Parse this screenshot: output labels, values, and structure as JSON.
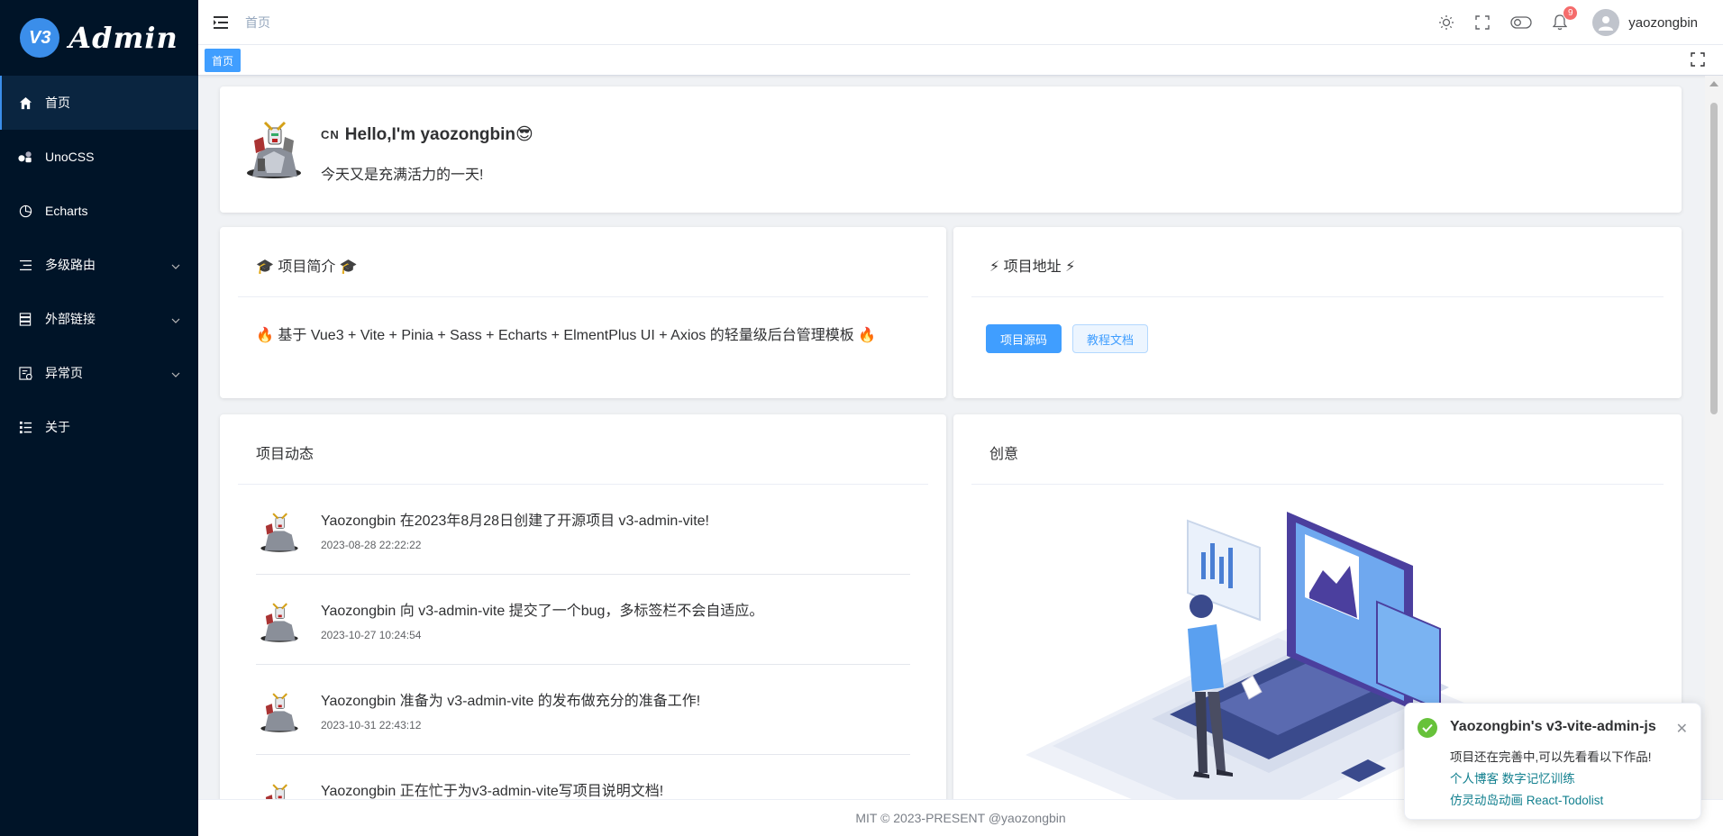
{
  "app": {
    "logo_badge": "V3",
    "logo_text": "Admin"
  },
  "sidebar": {
    "items": [
      {
        "label": "首页",
        "icon": "home-icon",
        "active": true
      },
      {
        "label": "UnoCSS",
        "icon": "shapes-icon"
      },
      {
        "label": "Echarts",
        "icon": "pie-chart-icon"
      },
      {
        "label": "多级路由",
        "icon": "menu-icon",
        "has_children": true
      },
      {
        "label": "外部链接",
        "icon": "server-icon",
        "has_children": true
      },
      {
        "label": "异常页",
        "icon": "error-page-icon",
        "has_children": true
      },
      {
        "label": "关于",
        "icon": "list-icon"
      }
    ]
  },
  "header": {
    "breadcrumb": "首页",
    "notification_count": "9",
    "username": "yaozongbin"
  },
  "tags": {
    "active": "首页"
  },
  "hello": {
    "flag": "CN",
    "title": "Hello,I'm yaozongbin😎",
    "subtitle": "今天又是充满活力的一天!"
  },
  "intro": {
    "title": "🎓 项目简介 🎓",
    "body": "🔥 基于 Vue3 + Vite + Pinia + Sass + Echarts + ElmentPlus UI + Axios 的轻量级后台管理模板 🔥"
  },
  "address": {
    "title": "⚡ 项目地址 ⚡",
    "source_button": "项目源码",
    "docs_button": "教程文档"
  },
  "dynamics": {
    "title": "项目动态",
    "items": [
      {
        "text": "Yaozongbin 在2023年8月28日创建了开源项目 v3-admin-vite!",
        "time": "2023-08-28 22:22:22"
      },
      {
        "text": "Yaozongbin 向 v3-admin-vite 提交了一个bug，多标签栏不会自适应。",
        "time": "2023-10-27 10:24:54"
      },
      {
        "text": "Yaozongbin 准备为 v3-admin-vite 的发布做充分的准备工作!",
        "time": "2023-10-31 22:43:12"
      },
      {
        "text": "Yaozongbin 正在忙于为v3-admin-vite写项目说明文档!",
        "time": ""
      }
    ]
  },
  "idea": {
    "title": "创意"
  },
  "footer": {
    "text": "MIT © 2023-PRESENT @yaozongbin"
  },
  "notification": {
    "title": "Yaozongbin's v3-vite-admin-js",
    "message": "项目还在完善中,可以先看看以下作品!",
    "link1": "个人博客 数字记忆训练",
    "link2": "仿灵动岛动画 React-Todolist"
  },
  "colors": {
    "sidebar_bg": "#001428",
    "primary": "#409eff",
    "success": "#67c23a",
    "danger": "#f56c6c"
  }
}
